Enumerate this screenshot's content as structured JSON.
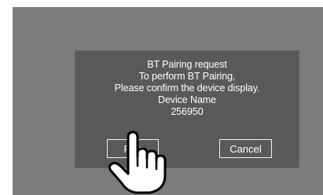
{
  "dialog": {
    "lines": [
      "BT Pairing request",
      "To perform BT Pairing,",
      "Please confirm the device display.",
      "Device Name",
      "256950"
    ],
    "pair_label": "Pair",
    "cancel_label": "Cancel"
  },
  "icons": {
    "pointer": "pointing-hand-icon"
  },
  "colors": {
    "screen_bg": "#7c7c7c",
    "dialog_bg": "#595959",
    "text": "#ffffff"
  }
}
